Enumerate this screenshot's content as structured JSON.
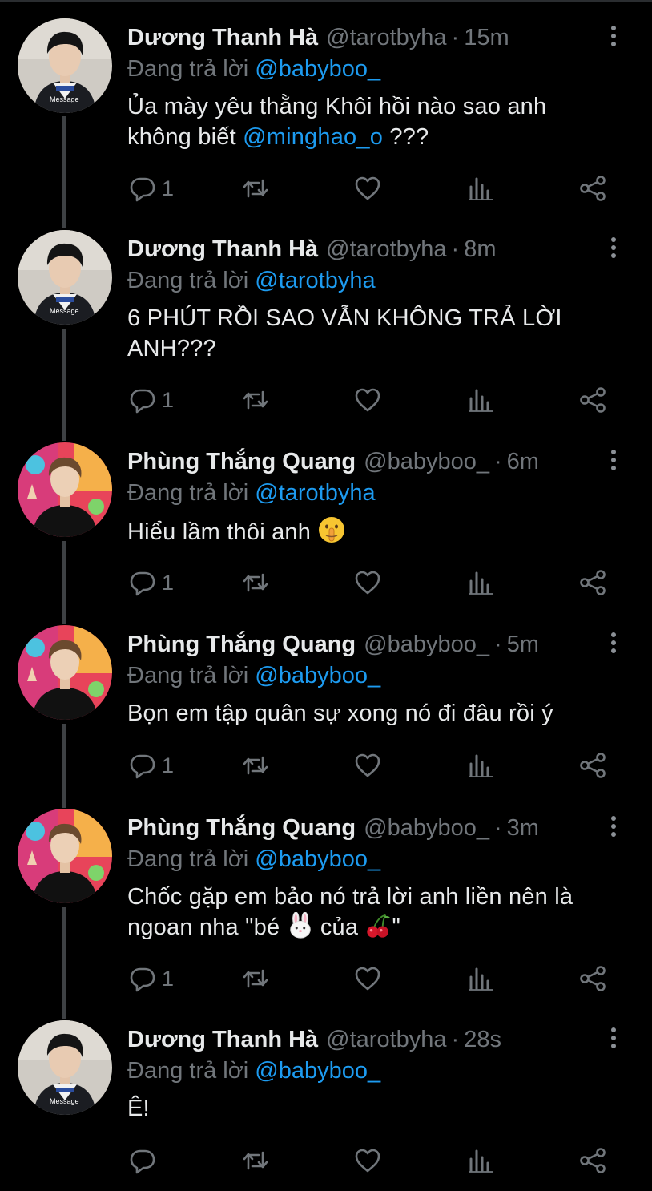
{
  "colors": {
    "background": "#000000",
    "text": "#e7e9ea",
    "muted": "#71767b",
    "mention": "#1d9bf0",
    "thread_line": "#3e4144"
  },
  "icons": [
    "reply-icon",
    "retweet-icon",
    "like-icon",
    "views-icon",
    "share-icon",
    "more-icon"
  ],
  "tweets": [
    {
      "name": "Dương Thanh Hà",
      "handle": "@tarotbyha",
      "separator": "·",
      "time": "15m",
      "reply_label": "Đang trả lời",
      "reply_to": "@babyboo_",
      "body_text_1": "Ủa mày yêu thằng Khôi hồi nào sao anh không biết",
      "body_mention": "@minghao_o",
      "body_text_2": "???",
      "reply_count": "1",
      "avatar": "tarotbyha"
    },
    {
      "name": "Dương Thanh Hà",
      "handle": "@tarotbyha",
      "separator": "·",
      "time": "8m",
      "reply_label": "Đang trả lời",
      "reply_to": "@tarotbyha",
      "body_text_1": "6 PHÚT RỒI SAO VẪN KHÔNG TRẢ LỜI ANH???",
      "reply_count": "1",
      "avatar": "tarotbyha"
    },
    {
      "name": "Phùng Thắng Quang",
      "handle": "@babyboo_",
      "separator": "·",
      "time": "6m",
      "reply_label": "Đang trả lời",
      "reply_to": "@tarotbyha",
      "body_text_1": "Hiểu lầm thôi anh",
      "emoji": "shushing-face",
      "reply_count": "1",
      "avatar": "babyboo_"
    },
    {
      "name": "Phùng Thắng Quang",
      "handle": "@babyboo_",
      "separator": "·",
      "time": "5m",
      "reply_label": "Đang trả lời",
      "reply_to": "@babyboo_",
      "body_text_1": "Bọn em tập quân sự xong nó đi đâu rồi ý",
      "reply_count": "1",
      "avatar": "babyboo_"
    },
    {
      "name": "Phùng Thắng Quang",
      "handle": "@babyboo_",
      "separator": "·",
      "time": "3m",
      "reply_label": "Đang trả lời",
      "reply_to": "@babyboo_",
      "body_text_1": "Chốc gặp em bảo nó trả lời anh liền nên là ngoan nha \"bé",
      "emoji_1": "rabbit-face",
      "body_text_2": "của",
      "emoji_2": "cherries",
      "body_text_3": "\"",
      "reply_count": "1",
      "avatar": "babyboo_"
    },
    {
      "name": "Dương Thanh Hà",
      "handle": "@tarotbyha",
      "separator": "·",
      "time": "28s",
      "reply_label": "Đang trả lời",
      "reply_to": "@babyboo_",
      "body_text_1": "Ê!",
      "reply_count": "",
      "avatar": "tarotbyha"
    }
  ]
}
